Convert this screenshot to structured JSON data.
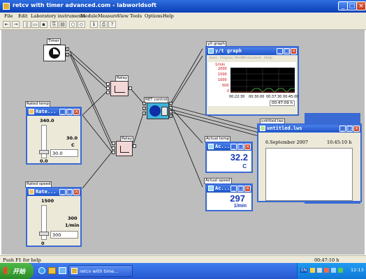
{
  "window": {
    "title": "retcv with timer advanced.com - labworldsoft"
  },
  "menu": [
    "File",
    "Edit",
    "Laboratory instruments",
    "Module",
    "Measure",
    "View",
    "Tools",
    "Options",
    "Help"
  ],
  "blocks": {
    "timer": "Timer",
    "relay1": "Relay",
    "relay2": "Relay",
    "ret_control": "RET control",
    "yt_graph": "y/t graph",
    "actual_temp": "Actual temp",
    "actual_speed": "Actual speed",
    "untitled": "untitled.lws",
    "rated_temp": "Rated temp",
    "rated_speed": "Rated speed"
  },
  "yt_window": {
    "title": "y/t graph",
    "menu": [
      "Axes",
      "Display Mode",
      "Evaluation",
      "Help"
    ],
    "unit": "1/min",
    "y_ticks": [
      "2000",
      "1500",
      "1000",
      "500",
      "0"
    ],
    "x_ticks": [
      "00:22:30",
      "00:30:00",
      "00:37:30",
      "00:45:00"
    ],
    "time": "00:47:09 h"
  },
  "chart_data": {
    "type": "line",
    "x_ticks": [
      "00:22:30",
      "00:30:00",
      "00:37:30",
      "00:45:00"
    ],
    "ylim": [
      0,
      2000
    ],
    "series": [
      {
        "color": "#4cd14c",
        "values": [
          0,
          0,
          0,
          0,
          0,
          0,
          300,
          300,
          0,
          300,
          300,
          0,
          300,
          300,
          0,
          300,
          300
        ]
      },
      {
        "color": "#d23a3a",
        "values": [
          0,
          0,
          0,
          0,
          0,
          0,
          0,
          0,
          0,
          0,
          0,
          0,
          0,
          0,
          0,
          0,
          0
        ]
      }
    ]
  },
  "actual_temp_window": {
    "title": "Ac...",
    "value": "32.2",
    "unit": "C"
  },
  "actual_speed_window": {
    "title": "Ac...",
    "value": "297",
    "unit": "1/min"
  },
  "rated_temp_window": {
    "title": "Rate...",
    "max": "340.0",
    "min": "0.0",
    "value": "30.0",
    "unit": "C",
    "input": "30.0"
  },
  "rated_speed_window": {
    "title": "Rate...",
    "max": "1500",
    "min": "0",
    "value": "300",
    "unit": "1/min",
    "input": "300"
  },
  "untitled_window": {
    "title": "untitled.lws",
    "date": "6.September 2007",
    "time": "10:45:10 h"
  },
  "status": {
    "help": "Push F1 for help",
    "time": "00:47:10 h"
  },
  "taskbar": {
    "start": "开始",
    "task": "retcv with time...",
    "lang": "EN",
    "clock": "12:13"
  }
}
